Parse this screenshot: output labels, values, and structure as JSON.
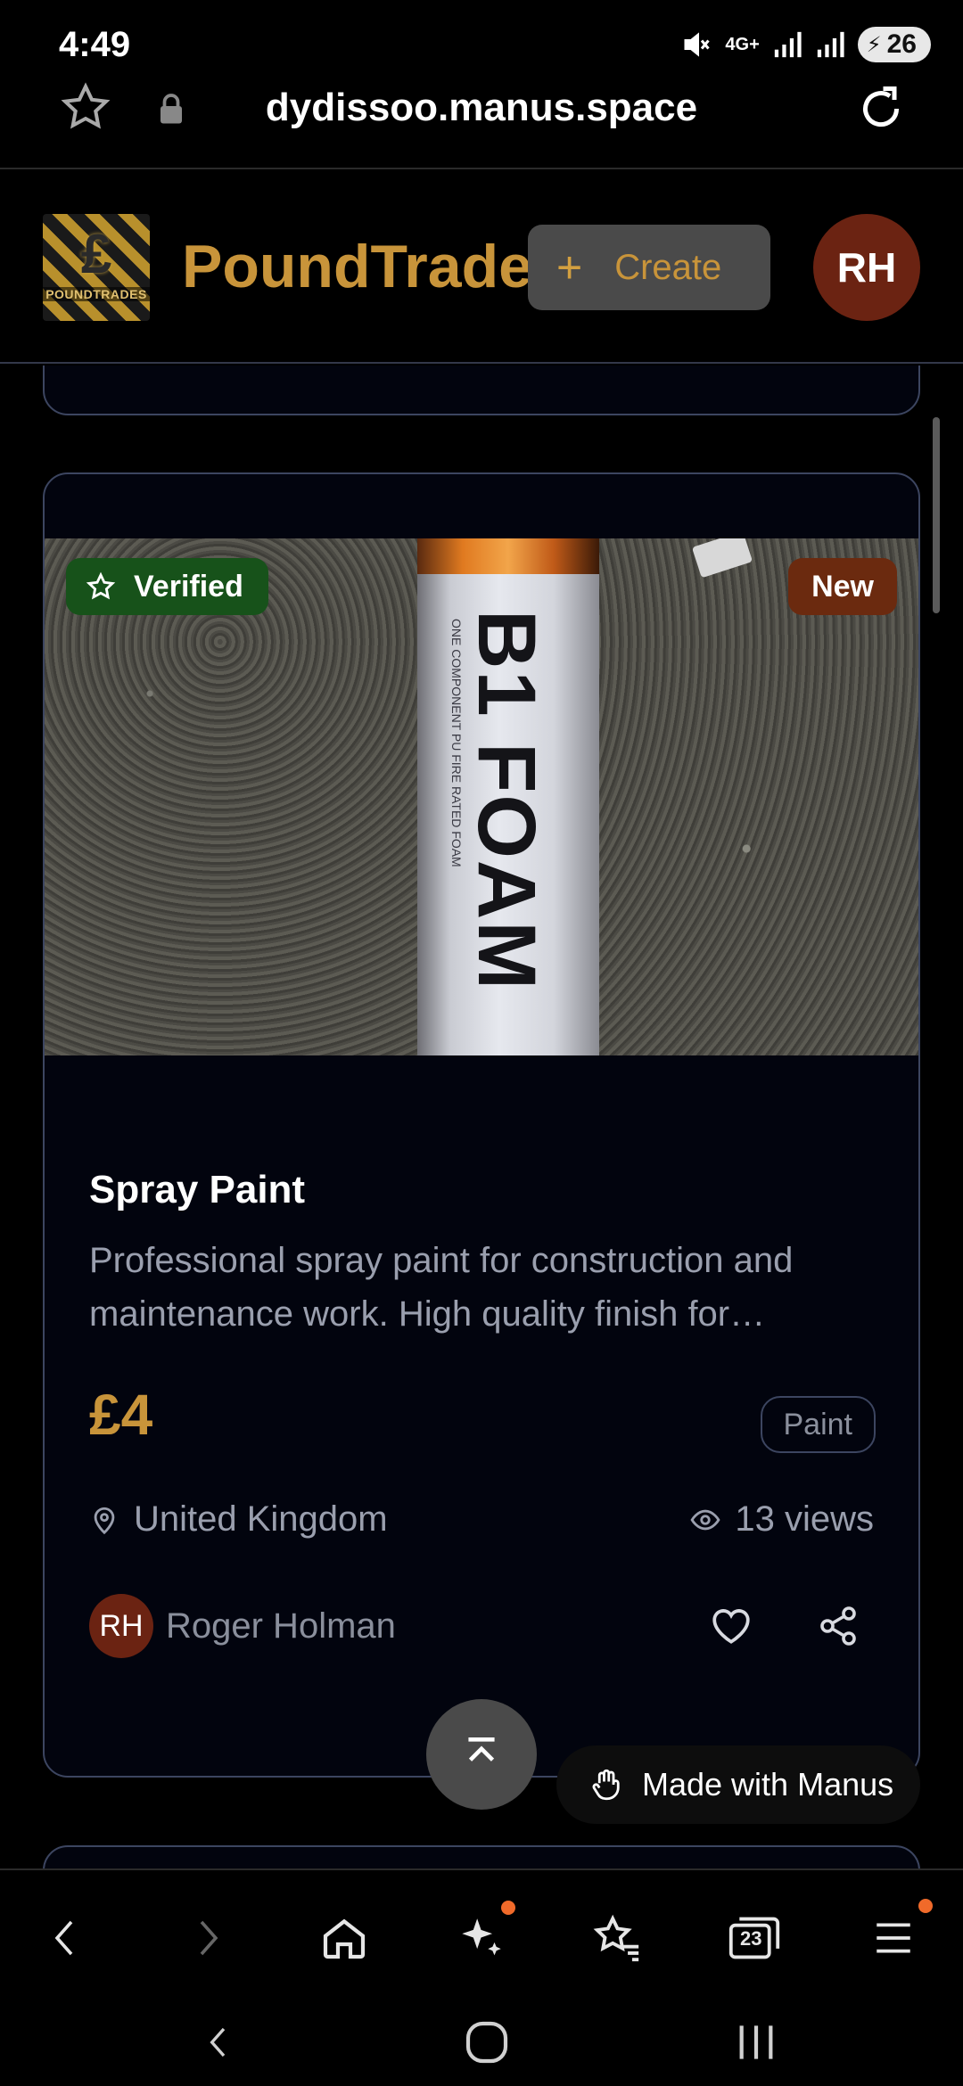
{
  "status_bar": {
    "time": "4:49",
    "network": "4G+",
    "battery": "26"
  },
  "browser": {
    "url": "dydissoo.manus.space"
  },
  "header": {
    "logo_text": "POUNDTRADES",
    "logo_glyph": "£",
    "brand": "PoundTrade",
    "create_label": "Create",
    "user_initials": "RH"
  },
  "listing": {
    "badge_verified": "Verified",
    "badge_new": "New",
    "image_text": "B1 FOAM",
    "image_small_text": "ONE COMPONENT PU FIRE RATED FOAM",
    "title": "Spray Paint",
    "description": "Professional spray paint for construction and maintenance work. High quality finish for…",
    "price": "£4",
    "category": "Paint",
    "location": "United Kingdom",
    "views": "13 views",
    "seller_initials": "RH",
    "seller_name": "Roger Holman"
  },
  "overlay": {
    "made_with": "Made with Manus"
  },
  "toolbar": {
    "tabs_count": "23"
  },
  "colors": {
    "accent_gold": "#c8943a",
    "verified_green": "#17521a",
    "new_brown": "#6b2a0f",
    "avatar_brown": "#6b2312",
    "card_border": "#3c4560",
    "notification_dot": "#f06a2a"
  }
}
